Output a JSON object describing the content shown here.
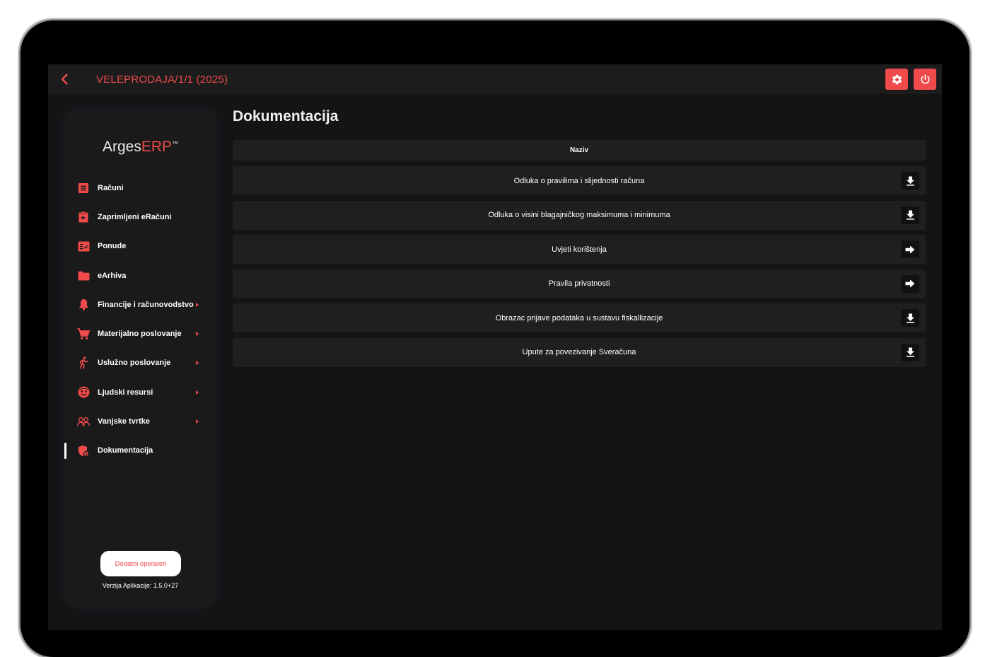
{
  "header": {
    "title": "VELEPRODAJA/1/1 (2025)",
    "back_icon": "chevron-left-icon",
    "settings_icon": "gear-icon",
    "power_icon": "power-icon",
    "accent_color": "#ef4b4b"
  },
  "sidebar": {
    "logo_main": "Arges",
    "logo_accent": "ERP",
    "logo_tm": "™",
    "items": [
      {
        "label": "Računi",
        "icon": "receipt-icon",
        "has_submenu": false
      },
      {
        "label": "Zaprimljeni eRačuni",
        "icon": "clipboard-in-icon",
        "has_submenu": false
      },
      {
        "label": "Ponude",
        "icon": "quote-icon",
        "has_submenu": false
      },
      {
        "label": "eArhiva",
        "icon": "folder-icon",
        "has_submenu": false
      },
      {
        "label": "Financije i računovodstvo",
        "icon": "bell-icon",
        "has_submenu": true
      },
      {
        "label": "Materijalno poslovanje",
        "icon": "cart-icon",
        "has_submenu": true
      },
      {
        "label": "Uslužno poslovanje",
        "icon": "runner-icon",
        "has_submenu": true
      },
      {
        "label": "Ljudski resursi",
        "icon": "face-icon",
        "has_submenu": true
      },
      {
        "label": "Vanjske tvrtke",
        "icon": "group-icon",
        "has_submenu": true
      },
      {
        "label": "Dokumentacija",
        "icon": "shield-doc-icon",
        "has_submenu": false,
        "active": true
      }
    ],
    "operators_button": "Dodatni operateri",
    "version": "Verzija Aplikacije: 1.5.0+27"
  },
  "main": {
    "title": "Dokumentacija",
    "column_header": "Naziv",
    "documents": [
      {
        "name": "Odluka o pravilima i slijednosti računa",
        "action": "download-icon"
      },
      {
        "name": "Odluka o visini blagajničkog maksimuma i minimuma",
        "action": "download-icon"
      },
      {
        "name": "Uvjeti korištenja",
        "action": "arrow-right-icon"
      },
      {
        "name": "Pravila privatnosti",
        "action": "arrow-right-icon"
      },
      {
        "name": "Obrazac prijave podataka u sustavu fiskallizacije",
        "action": "download-icon"
      },
      {
        "name": "Upute za povezivanje Sveračuna",
        "action": "download-icon"
      }
    ]
  }
}
